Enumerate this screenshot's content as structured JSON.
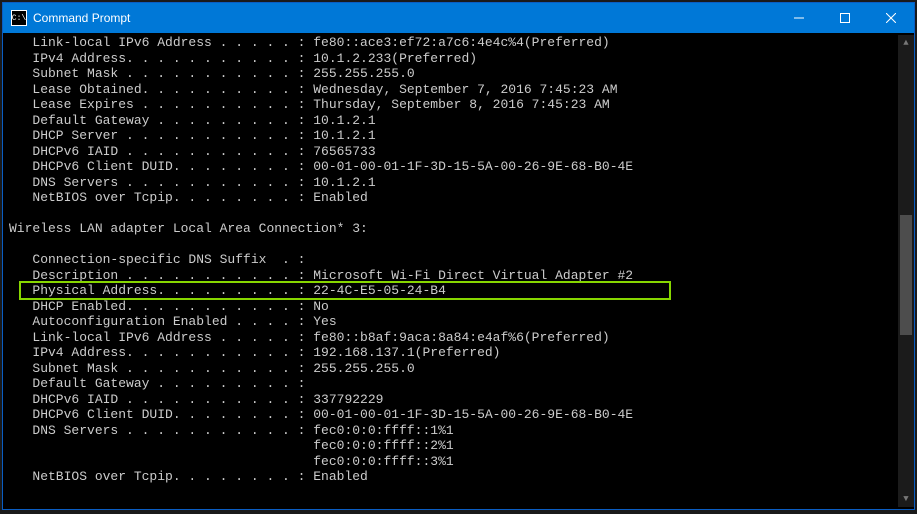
{
  "window": {
    "title": "Command Prompt"
  },
  "sections": {
    "first": {
      "lines": [
        {
          "label": "Link-local IPv6 Address",
          "dots": " . . . . . ",
          "value": "fe80::ace3:ef72:a7c6:4e4c%4(Preferred)"
        },
        {
          "label": "IPv4 Address",
          "dots": ". . . . . . . . . . . ",
          "value": "10.1.2.233(Preferred)"
        },
        {
          "label": "Subnet Mask",
          "dots": " . . . . . . . . . . . ",
          "value": "255.255.255.0"
        },
        {
          "label": "Lease Obtained",
          "dots": ". . . . . . . . . . ",
          "value": "Wednesday, September 7, 2016 7:45:23 AM"
        },
        {
          "label": "Lease Expires",
          "dots": " . . . . . . . . . . ",
          "value": "Thursday, September 8, 2016 7:45:23 AM"
        },
        {
          "label": "Default Gateway",
          "dots": " . . . . . . . . . ",
          "value": "10.1.2.1"
        },
        {
          "label": "DHCP Server",
          "dots": " . . . . . . . . . . . ",
          "value": "10.1.2.1"
        },
        {
          "label": "DHCPv6 IAID",
          "dots": " . . . . . . . . . . . ",
          "value": "76565733"
        },
        {
          "label": "DHCPv6 Client DUID",
          "dots": ". . . . . . . . ",
          "value": "00-01-00-01-1F-3D-15-5A-00-26-9E-68-B0-4E"
        },
        {
          "label": "DNS Servers",
          "dots": " . . . . . . . . . . . ",
          "value": "10.1.2.1"
        },
        {
          "label": "NetBIOS over Tcpip",
          "dots": ". . . . . . . . ",
          "value": "Enabled"
        }
      ]
    },
    "adapterHeader": "Wireless LAN adapter Local Area Connection* 3:",
    "second": {
      "lines": [
        {
          "label": "Connection-specific DNS Suffix ",
          "dots": " . ",
          "value": ""
        },
        {
          "label": "Description",
          "dots": " . . . . . . . . . . . ",
          "value": "Microsoft Wi-Fi Direct Virtual Adapter #2"
        },
        {
          "label": "Physical Address",
          "dots": ". . . . . . . . . ",
          "value": "22-4C-E5-05-24-B4"
        },
        {
          "label": "DHCP Enabled",
          "dots": ". . . . . . . . . . . ",
          "value": "No"
        },
        {
          "label": "Autoconfiguration Enabled",
          "dots": " . . . . ",
          "value": "Yes"
        },
        {
          "label": "Link-local IPv6 Address",
          "dots": " . . . . . ",
          "value": "fe80::b8af:9aca:8a84:e4af%6(Preferred)"
        },
        {
          "label": "IPv4 Address",
          "dots": ". . . . . . . . . . . ",
          "value": "192.168.137.1(Preferred)"
        },
        {
          "label": "Subnet Mask",
          "dots": " . . . . . . . . . . . ",
          "value": "255.255.255.0"
        },
        {
          "label": "Default Gateway",
          "dots": " . . . . . . . . . ",
          "value": ""
        },
        {
          "label": "DHCPv6 IAID",
          "dots": " . . . . . . . . . . . ",
          "value": "337792229"
        },
        {
          "label": "DHCPv6 Client DUID",
          "dots": ". . . . . . . . ",
          "value": "00-01-00-01-1F-3D-15-5A-00-26-9E-68-B0-4E"
        },
        {
          "label": "DNS Servers",
          "dots": " . . . . . . . . . . . ",
          "value": "fec0:0:0:ffff::1%1"
        }
      ],
      "dnsExtra": [
        "fec0:0:0:ffff::2%1",
        "fec0:0:0:ffff::3%1"
      ],
      "tail": {
        "label": "NetBIOS over Tcpip",
        "dots": ". . . . . . . . ",
        "value": "Enabled"
      }
    }
  },
  "highlightLineIndex": 2
}
